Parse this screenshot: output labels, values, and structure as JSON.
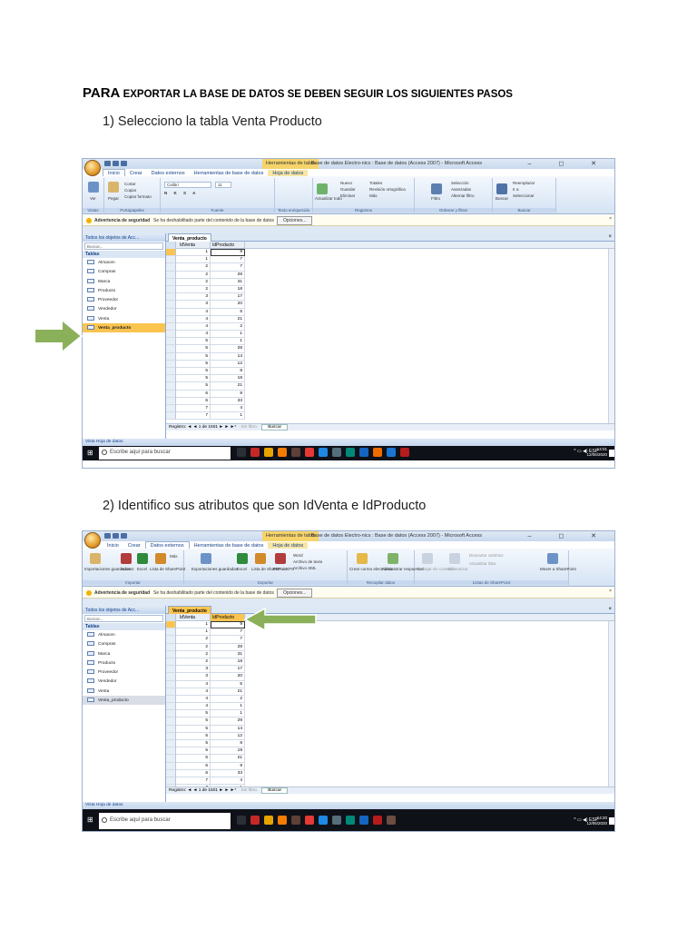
{
  "heading": {
    "big": "PARA",
    "rest": " EXPORTAR LA BASE DE DATOS SE DEBEN SEGUIR LOS SIGUIENTES PASOS"
  },
  "step1": "1)  Selecciono la tabla Venta Producto",
  "step2": "2)  Identifico sus atributos que son IdVenta e IdProducto",
  "colors": {
    "accent_orange": "#fbc44f",
    "arrow_green": "#8bb05a",
    "ribbon_blue": "#d5e3f4",
    "taskbar": "#0f1118"
  },
  "access": {
    "contextual_tab": "Herramientas de tabla",
    "window_title": "Base de datos Electro-nics : Base de datos (Access 2007) - Microsoft Access",
    "window_controls": "– ◻ ✕",
    "tabs1": [
      "Inicio",
      "Crear",
      "Datos externos",
      "Herramientas de base de datos",
      "Hoja de datos"
    ],
    "tabs2": [
      "Inicio",
      "Crear",
      "Datos externos",
      "Herramientas de base de datos",
      "Hoja de datos"
    ],
    "ribbon1": {
      "ver": "Ver",
      "pegar": "Pegar",
      "cortar": "Cortar",
      "copiar": "Copiar",
      "copiar_formato": "Copiar formato",
      "font": "Calibri",
      "size": "11",
      "actualizar": "Actualizar todo",
      "nuevo": "Nuevo",
      "guardar": "Guardar",
      "eliminar": "Eliminar",
      "totales": "Totales",
      "ortografia": "Revisión ortográfica",
      "mas": "Más",
      "filtro": "Filtro",
      "seleccion": "Selección",
      "avanzadas": "Avanzadas",
      "alternar": "Alternar filtro",
      "buscar": "Buscar",
      "reemplazar": "Reemplazar",
      "ir_a": "Ir a",
      "seleccionar": "Seleccionar",
      "groups": [
        "Vistas",
        "Portapapeles",
        "Fuente",
        "Texto enriquecido",
        "Registros",
        "Ordenar y filtrar",
        "Buscar"
      ]
    },
    "ribbon2": {
      "importaciones": "Importaciones guardadas",
      "access": "Access",
      "excel": "Excel",
      "sharepoint": "Lista de SharePoint",
      "mas": "Más",
      "exportaciones": "Exportaciones guardadas",
      "excel2": "Excel",
      "sharepoint2": "Lista de SharePoint",
      "pdf": "PDF o XPS",
      "word": "Word",
      "archivo_texto": "Archivo de texto",
      "archivo_xml": "Archivo XML",
      "crear_correo": "Crear correo electrónico",
      "admin_respuestas": "Administrar respuestas",
      "trabajar": "Trabajar sin conexión",
      "sincronizar": "Sincronizar",
      "descartar": "Descartar cambios",
      "actualizar_lista": "Actualizar lista",
      "mover": "Mover a SharePoint",
      "groups": [
        "Importar",
        "Exportar",
        "Recopilar datos",
        "Listas de SharePoint"
      ]
    },
    "message_bar": {
      "title": "Advertencia de seguridad",
      "text": "Se ha deshabilitado parte del contenido de la base de datos",
      "button": "Opciones..."
    },
    "nav": {
      "header": "Todos los objetos de Acc...",
      "search": "Buscar...",
      "group": "Tablas",
      "items": [
        "Almacen",
        "Compras",
        "Marca",
        "Producto",
        "Proveedor",
        "Vendedor",
        "Venta",
        "Venta_producto"
      ]
    },
    "doc_tab": "Venta_producto",
    "columns": [
      "IdVenta",
      "IdProducto"
    ],
    "rows": [
      [
        "1",
        "9"
      ],
      [
        "1",
        "7"
      ],
      [
        "2",
        "7"
      ],
      [
        "2",
        "28"
      ],
      [
        "2",
        "31"
      ],
      [
        "2",
        "18"
      ],
      [
        "3",
        "17"
      ],
      [
        "3",
        "20"
      ],
      [
        "4",
        "5"
      ],
      [
        "4",
        "21"
      ],
      [
        "4",
        "2"
      ],
      [
        "4",
        "1"
      ],
      [
        "5",
        "1"
      ],
      [
        "5",
        "29"
      ],
      [
        "5",
        "14"
      ],
      [
        "5",
        "12"
      ],
      [
        "5",
        "8"
      ],
      [
        "5",
        "19"
      ],
      [
        "5",
        "21"
      ],
      [
        "6",
        "9"
      ],
      [
        "6",
        "33"
      ],
      [
        "7",
        "4"
      ],
      [
        "7",
        "1"
      ]
    ],
    "rows2": [
      [
        "1",
        "9"
      ],
      [
        "1",
        "7"
      ],
      [
        "2",
        "7"
      ],
      [
        "2",
        "28"
      ],
      [
        "2",
        "31"
      ],
      [
        "2",
        "18"
      ],
      [
        "3",
        "17"
      ],
      [
        "3",
        "20"
      ],
      [
        "4",
        "5"
      ],
      [
        "4",
        "21"
      ],
      [
        "4",
        "2"
      ],
      [
        "4",
        "1"
      ],
      [
        "5",
        "1"
      ],
      [
        "5",
        "29"
      ],
      [
        "5",
        "14"
      ],
      [
        "5",
        "12"
      ],
      [
        "5",
        "8"
      ],
      [
        "5",
        "19"
      ],
      [
        "5",
        "21"
      ],
      [
        "6",
        "9"
      ],
      [
        "6",
        "33"
      ],
      [
        "7",
        "4"
      ],
      [
        "7",
        "1"
      ]
    ],
    "record_nav": {
      "label": "Registro:",
      "position": "1 de 1501",
      "filter": "Sin filtro",
      "search": "Buscar"
    },
    "status": "Vista Hoja de datos",
    "taskbar": {
      "search": "Escribe aquí para buscar",
      "lang": "ESP",
      "time1": "14:01",
      "date1": "12/06/2020",
      "time2": "14:20",
      "date2": "12/06/2020"
    }
  }
}
